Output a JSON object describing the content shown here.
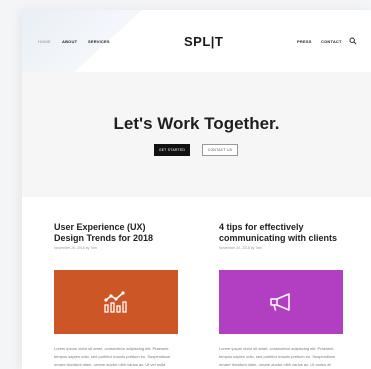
{
  "nav": {
    "items_left": [
      "HOME",
      "ABOUT",
      "SERVICES"
    ],
    "logo": "SPL|T",
    "items_right": [
      "PRESS",
      "CONTACT"
    ]
  },
  "hero": {
    "title": "Let's Work Together.",
    "primary_button": "GET STARTED",
    "secondary_button": "CONTACT US"
  },
  "posts": [
    {
      "title": "User Experience (UX) Design Trends for 2018",
      "meta": "November 20, 2018 by Tom",
      "image_icon": "analytics-chart-icon",
      "image_color": "#cc5626",
      "excerpt": "Lorem ipsum dolor sit amet, consectetur adipiscing elit. Praesent tempus sapien odio, sed porttitor mauris pretium eu. Suspendisse ornare tincidunt diam, ornare auctor nibh varius ac. Ut vel nulla"
    },
    {
      "title": "4 tips for effectively communicating with clients",
      "meta": "November 20, 2018 by Tom",
      "image_icon": "megaphone-icon",
      "image_color": "#b23fc2",
      "excerpt": "Lorem ipsum dolor sit amet, consectetur adipiscing elit. Praesent tempus sapien odio, sed porttitor mauris pretium eu. Suspendisse ornare tincidunt diam, ornare auctor nibh varius ac. Ut varius at"
    }
  ]
}
